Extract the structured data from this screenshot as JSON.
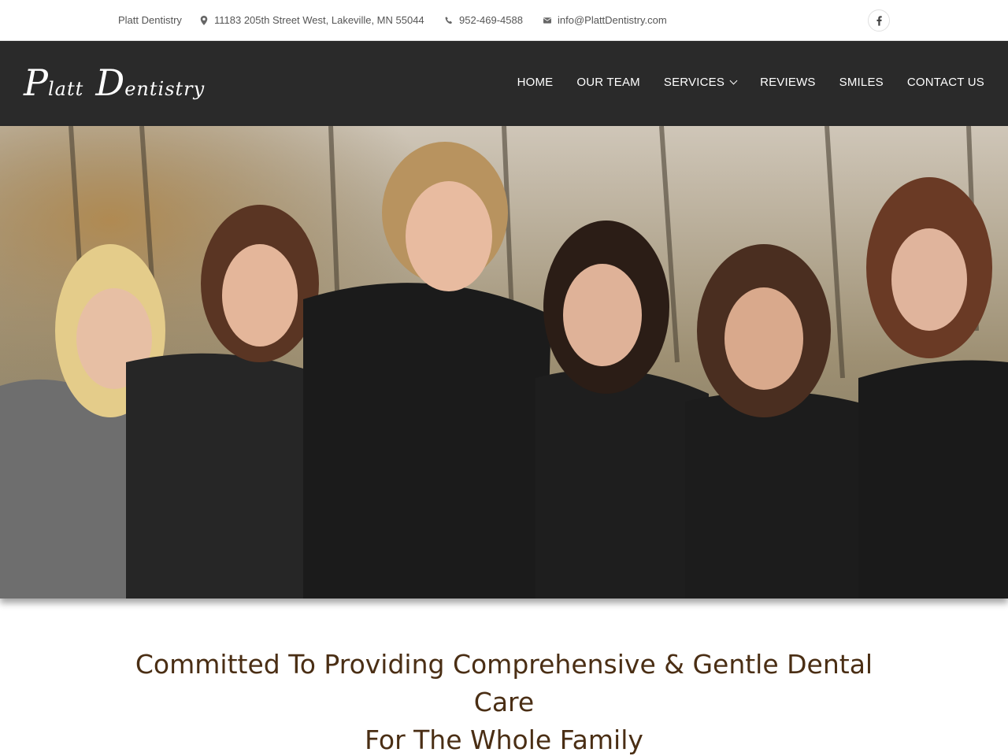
{
  "topbar": {
    "practice_name": "Platt Dentistry",
    "address": "11183 205th Street West, Lakeville, MN 55044",
    "phone": "952-469-4588",
    "email": "info@PlattDentistry.com",
    "icons": [
      "map-marker-icon",
      "phone-icon",
      "envelope-icon",
      "facebook-icon"
    ]
  },
  "logo": {
    "first_initial": "P",
    "first_rest": "latt",
    "second_initial": "D",
    "second_rest": "entistry"
  },
  "nav": {
    "items": [
      {
        "label": "HOME"
      },
      {
        "label": "OUR TEAM"
      },
      {
        "label": "SERVICES"
      },
      {
        "label": "REVIEWS"
      },
      {
        "label": "SMILES"
      },
      {
        "label": "CONTACT US"
      }
    ]
  },
  "hero": {
    "image": "team-photo",
    "colors": {
      "sky": "#cfc6b8",
      "trees": "#8a7a5a",
      "clothing": "#1c1c1c"
    }
  },
  "tagline": {
    "line1": "Committed To Providing Comprehensive & Gentle Dental Care",
    "line2": "For The Whole Family"
  },
  "colors": {
    "header_bg": "#2a2a2a",
    "tagline": "#4a2e14"
  }
}
